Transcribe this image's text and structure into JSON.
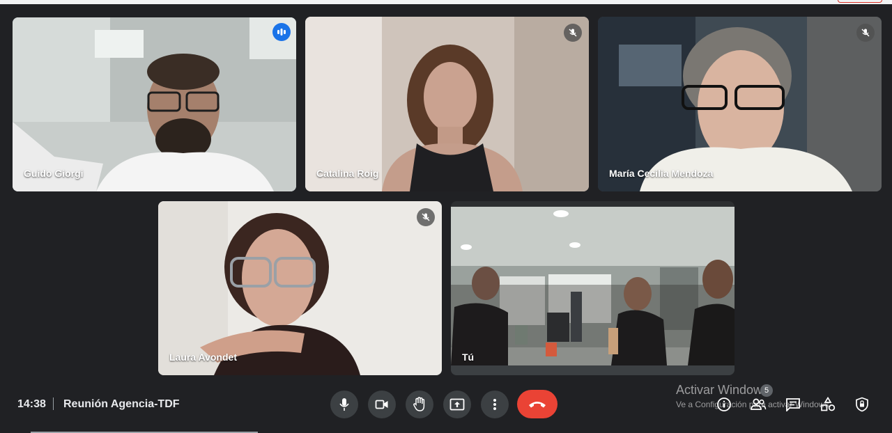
{
  "tiles": [
    {
      "name": "Guido Giorgi",
      "state": "speaking"
    },
    {
      "name": "Catalina Roig",
      "state": "muted"
    },
    {
      "name": "María Cecilia Mendoza",
      "state": "muted"
    },
    {
      "name": "Laura Avondet",
      "state": "muted"
    },
    {
      "name": "Tú",
      "state": "self"
    }
  ],
  "footer": {
    "time": "14:38",
    "meeting_title": "Reunión Agencia-TDF"
  },
  "controls": {
    "mic": "microphone-icon",
    "camera": "camera-icon",
    "hand": "raise-hand-icon",
    "present": "present-screen-icon",
    "more": "more-options-icon",
    "end": "hang-up-icon"
  },
  "right_panel": {
    "participants_count": "5",
    "icons": [
      "info-icon",
      "people-icon",
      "chat-icon",
      "activities-icon",
      "host-controls-icon"
    ]
  },
  "watermark": {
    "line1": "Activar Windows",
    "line2": "Ve a Configuración para activar Windows."
  },
  "colors": {
    "background": "#202124",
    "accent": "#8ab4f8",
    "speaking": "#1a73e8",
    "end_call": "#ea4335",
    "control_bg": "#3c4043"
  }
}
